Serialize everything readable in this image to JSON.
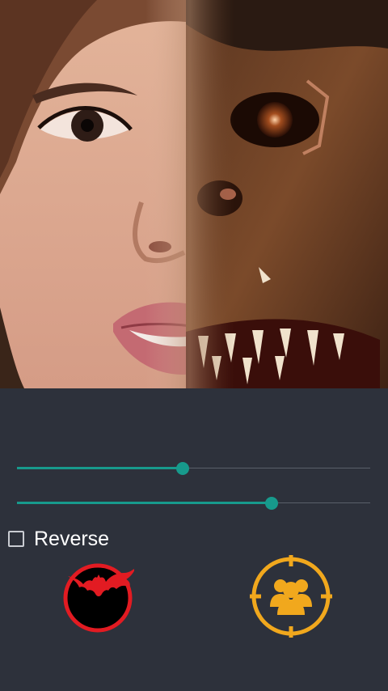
{
  "controls": {
    "slider_top": {
      "value": 0.47
    },
    "slider_bottom": {
      "value": 0.72
    },
    "reverse": {
      "label": "Reverse",
      "checked": false
    }
  },
  "buttons": {
    "effect_icon": "bat-icon",
    "faces_icon": "group-target-icon"
  },
  "colors": {
    "background": "#2d313b",
    "accent": "#179a8c",
    "bat_red": "#e21b22",
    "target_orange": "#f1a81d"
  }
}
